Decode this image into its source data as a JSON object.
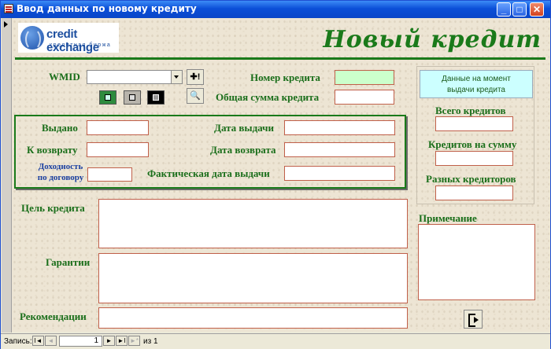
{
  "window": {
    "title": "Ввод данных по новому кредиту",
    "minimize": "_",
    "maximize": "□",
    "close": "✕"
  },
  "logo": {
    "brand": "credit exchange",
    "sub": "кредитная биржа"
  },
  "form_title": "Новый кредит",
  "labels": {
    "wmid": "WMID",
    "credit_number": "Номер кредита",
    "total_sum": "Общая сумма кредита",
    "issued": "Выдано",
    "to_return": "К возврату",
    "yield_line1": "Доходность",
    "yield_line2": "по договору",
    "issue_date": "Дата выдачи",
    "return_date": "Дата возврата",
    "actual_issue_date": "Фактическая дата выдачи",
    "purpose": "Цель кредита",
    "guarantees": "Гарантии",
    "recommendations": "Рекомендации",
    "snapshot_line1": "Данные на момент",
    "snapshot_line2": "выдачи кредита",
    "total_credits": "Всего кредитов",
    "credits_for_sum": "Кредитов на сумму",
    "different_creditors": "Разных кредиторов",
    "note": "Примечание"
  },
  "buttons": {
    "wmid_action": "✚!",
    "preview": "🔍"
  },
  "colors": {
    "green_button": "#2e8b3e",
    "gray_button": "#b8b4ac",
    "black_button": "#000000"
  },
  "navigation": {
    "record_label": "Запись:",
    "first": "I◄",
    "prev": "◄",
    "current": "1",
    "next": "►",
    "last": "►I",
    "new": "►*",
    "of": "из 1"
  }
}
